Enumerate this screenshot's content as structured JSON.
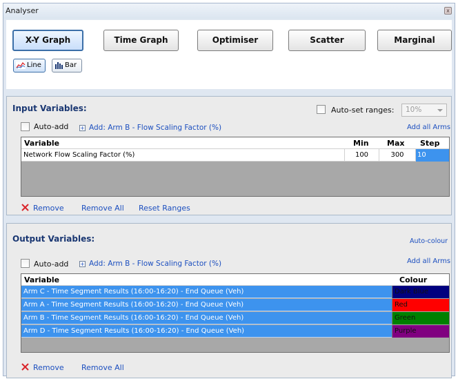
{
  "window": {
    "title": "Analyser",
    "close_glyph": "x"
  },
  "tabs": [
    {
      "label": "X-Y Graph",
      "active": true
    },
    {
      "label": "Time Graph",
      "active": false
    },
    {
      "label": "Optimiser",
      "active": false
    },
    {
      "label": "Scatter",
      "active": false
    },
    {
      "label": "Marginal",
      "active": false
    }
  ],
  "graph_type": {
    "line_label": "Line",
    "line_icon": "line-chart-icon",
    "bar_label": "Bar",
    "bar_icon": "bar-chart-icon",
    "selected": "Line"
  },
  "input": {
    "title": "Input Variables:",
    "auto_set_ranges_label": "Auto-set ranges:",
    "auto_set_ranges_checked": false,
    "range_value": "10%",
    "auto_add_label": "Auto-add",
    "auto_add_checked": false,
    "add_label": "Add: Arm B - Flow Scaling Factor (%)",
    "add_all_arms": "Add all Arms",
    "columns": {
      "variable": "Variable",
      "min": "Min",
      "max": "Max",
      "step": "Step"
    },
    "rows": [
      {
        "variable": "Network Flow Scaling Factor (%)",
        "min": "100",
        "max": "300",
        "step": "10"
      }
    ],
    "remove_label": "Remove",
    "remove_all_label": "Remove All",
    "reset_ranges_label": "Reset Ranges"
  },
  "output": {
    "title": "Output Variables:",
    "auto_colour_label": "Auto-colour",
    "auto_add_label": "Auto-add",
    "auto_add_checked": false,
    "add_label": "Add: Arm B - Flow Scaling Factor (%)",
    "add_all_arms": "Add all Arms",
    "columns": {
      "variable": "Variable",
      "colour": "Colour"
    },
    "rows": [
      {
        "variable": "Arm C - Time Segment Results (16:00-16:20) - End Queue (Veh)",
        "colour": "Dark Blue",
        "hex": "#00007f"
      },
      {
        "variable": "Arm A - Time Segment Results (16:00-16:20) - End Queue (Veh)",
        "colour": "Red",
        "hex": "#ff0000"
      },
      {
        "variable": "Arm B - Time Segment Results (16:00-16:20) - End Queue (Veh)",
        "colour": "Green",
        "hex": "#008000"
      },
      {
        "variable": "Arm D - Time Segment Results (16:00-16:20) - End Queue (Veh)",
        "colour": "Purple",
        "hex": "#800080"
      }
    ],
    "remove_label": "Remove",
    "remove_all_label": "Remove All"
  },
  "colors": {
    "accent": "#3b6fa8",
    "selection": "#3d93ee",
    "link": "#1c4fbf",
    "remove_x": "#d9262c"
  }
}
